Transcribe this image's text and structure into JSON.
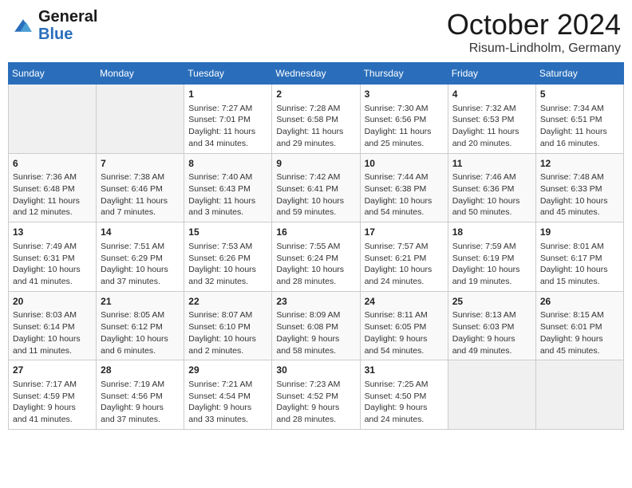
{
  "header": {
    "logo_line1": "General",
    "logo_line2": "Blue",
    "month": "October 2024",
    "location": "Risum-Lindholm, Germany"
  },
  "weekdays": [
    "Sunday",
    "Monday",
    "Tuesday",
    "Wednesday",
    "Thursday",
    "Friday",
    "Saturday"
  ],
  "weeks": [
    [
      {
        "day": "",
        "empty": true
      },
      {
        "day": "",
        "empty": true
      },
      {
        "day": "1",
        "sunrise": "Sunrise: 7:27 AM",
        "sunset": "Sunset: 7:01 PM",
        "daylight": "Daylight: 11 hours and 34 minutes."
      },
      {
        "day": "2",
        "sunrise": "Sunrise: 7:28 AM",
        "sunset": "Sunset: 6:58 PM",
        "daylight": "Daylight: 11 hours and 29 minutes."
      },
      {
        "day": "3",
        "sunrise": "Sunrise: 7:30 AM",
        "sunset": "Sunset: 6:56 PM",
        "daylight": "Daylight: 11 hours and 25 minutes."
      },
      {
        "day": "4",
        "sunrise": "Sunrise: 7:32 AM",
        "sunset": "Sunset: 6:53 PM",
        "daylight": "Daylight: 11 hours and 20 minutes."
      },
      {
        "day": "5",
        "sunrise": "Sunrise: 7:34 AM",
        "sunset": "Sunset: 6:51 PM",
        "daylight": "Daylight: 11 hours and 16 minutes."
      }
    ],
    [
      {
        "day": "6",
        "sunrise": "Sunrise: 7:36 AM",
        "sunset": "Sunset: 6:48 PM",
        "daylight": "Daylight: 11 hours and 12 minutes."
      },
      {
        "day": "7",
        "sunrise": "Sunrise: 7:38 AM",
        "sunset": "Sunset: 6:46 PM",
        "daylight": "Daylight: 11 hours and 7 minutes."
      },
      {
        "day": "8",
        "sunrise": "Sunrise: 7:40 AM",
        "sunset": "Sunset: 6:43 PM",
        "daylight": "Daylight: 11 hours and 3 minutes."
      },
      {
        "day": "9",
        "sunrise": "Sunrise: 7:42 AM",
        "sunset": "Sunset: 6:41 PM",
        "daylight": "Daylight: 10 hours and 59 minutes."
      },
      {
        "day": "10",
        "sunrise": "Sunrise: 7:44 AM",
        "sunset": "Sunset: 6:38 PM",
        "daylight": "Daylight: 10 hours and 54 minutes."
      },
      {
        "day": "11",
        "sunrise": "Sunrise: 7:46 AM",
        "sunset": "Sunset: 6:36 PM",
        "daylight": "Daylight: 10 hours and 50 minutes."
      },
      {
        "day": "12",
        "sunrise": "Sunrise: 7:48 AM",
        "sunset": "Sunset: 6:33 PM",
        "daylight": "Daylight: 10 hours and 45 minutes."
      }
    ],
    [
      {
        "day": "13",
        "sunrise": "Sunrise: 7:49 AM",
        "sunset": "Sunset: 6:31 PM",
        "daylight": "Daylight: 10 hours and 41 minutes."
      },
      {
        "day": "14",
        "sunrise": "Sunrise: 7:51 AM",
        "sunset": "Sunset: 6:29 PM",
        "daylight": "Daylight: 10 hours and 37 minutes."
      },
      {
        "day": "15",
        "sunrise": "Sunrise: 7:53 AM",
        "sunset": "Sunset: 6:26 PM",
        "daylight": "Daylight: 10 hours and 32 minutes."
      },
      {
        "day": "16",
        "sunrise": "Sunrise: 7:55 AM",
        "sunset": "Sunset: 6:24 PM",
        "daylight": "Daylight: 10 hours and 28 minutes."
      },
      {
        "day": "17",
        "sunrise": "Sunrise: 7:57 AM",
        "sunset": "Sunset: 6:21 PM",
        "daylight": "Daylight: 10 hours and 24 minutes."
      },
      {
        "day": "18",
        "sunrise": "Sunrise: 7:59 AM",
        "sunset": "Sunset: 6:19 PM",
        "daylight": "Daylight: 10 hours and 19 minutes."
      },
      {
        "day": "19",
        "sunrise": "Sunrise: 8:01 AM",
        "sunset": "Sunset: 6:17 PM",
        "daylight": "Daylight: 10 hours and 15 minutes."
      }
    ],
    [
      {
        "day": "20",
        "sunrise": "Sunrise: 8:03 AM",
        "sunset": "Sunset: 6:14 PM",
        "daylight": "Daylight: 10 hours and 11 minutes."
      },
      {
        "day": "21",
        "sunrise": "Sunrise: 8:05 AM",
        "sunset": "Sunset: 6:12 PM",
        "daylight": "Daylight: 10 hours and 6 minutes."
      },
      {
        "day": "22",
        "sunrise": "Sunrise: 8:07 AM",
        "sunset": "Sunset: 6:10 PM",
        "daylight": "Daylight: 10 hours and 2 minutes."
      },
      {
        "day": "23",
        "sunrise": "Sunrise: 8:09 AM",
        "sunset": "Sunset: 6:08 PM",
        "daylight": "Daylight: 9 hours and 58 minutes."
      },
      {
        "day": "24",
        "sunrise": "Sunrise: 8:11 AM",
        "sunset": "Sunset: 6:05 PM",
        "daylight": "Daylight: 9 hours and 54 minutes."
      },
      {
        "day": "25",
        "sunrise": "Sunrise: 8:13 AM",
        "sunset": "Sunset: 6:03 PM",
        "daylight": "Daylight: 9 hours and 49 minutes."
      },
      {
        "day": "26",
        "sunrise": "Sunrise: 8:15 AM",
        "sunset": "Sunset: 6:01 PM",
        "daylight": "Daylight: 9 hours and 45 minutes."
      }
    ],
    [
      {
        "day": "27",
        "sunrise": "Sunrise: 7:17 AM",
        "sunset": "Sunset: 4:59 PM",
        "daylight": "Daylight: 9 hours and 41 minutes."
      },
      {
        "day": "28",
        "sunrise": "Sunrise: 7:19 AM",
        "sunset": "Sunset: 4:56 PM",
        "daylight": "Daylight: 9 hours and 37 minutes."
      },
      {
        "day": "29",
        "sunrise": "Sunrise: 7:21 AM",
        "sunset": "Sunset: 4:54 PM",
        "daylight": "Daylight: 9 hours and 33 minutes."
      },
      {
        "day": "30",
        "sunrise": "Sunrise: 7:23 AM",
        "sunset": "Sunset: 4:52 PM",
        "daylight": "Daylight: 9 hours and 28 minutes."
      },
      {
        "day": "31",
        "sunrise": "Sunrise: 7:25 AM",
        "sunset": "Sunset: 4:50 PM",
        "daylight": "Daylight: 9 hours and 24 minutes."
      },
      {
        "day": "",
        "empty": true
      },
      {
        "day": "",
        "empty": true
      }
    ]
  ],
  "row_classes": [
    "row-1",
    "row-2",
    "row-3",
    "row-4",
    "row-5"
  ]
}
